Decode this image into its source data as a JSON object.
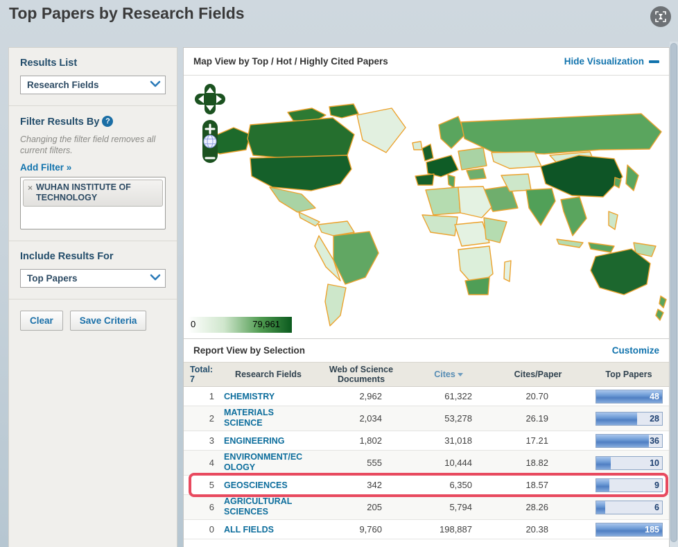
{
  "header": {
    "title": "Top Papers by Research Fields"
  },
  "icons": {
    "expand": "expand-hourglass-icon",
    "help": "?",
    "dropdown_chevron": "chevron-down-icon",
    "remove_tag": "×",
    "hide_dash": "minus-icon",
    "sort": "triangle-down-icon",
    "map_pan": "pan-arrows-icon",
    "map_zoom_in": "+",
    "map_globe": "globe-icon",
    "map_zoom_out": "−"
  },
  "sidebar": {
    "results_list": {
      "label": "Results List",
      "selected": "Research Fields"
    },
    "filter": {
      "heading": "Filter Results By",
      "note": "Changing the filter field removes all current filters.",
      "add_filter_label": "Add Filter »",
      "tag": {
        "remove": "×",
        "label": "WUHAN INSTITUTE OF TECHNOLOGY"
      }
    },
    "include_results": {
      "label": "Include Results For",
      "selected": "Top Papers"
    },
    "actions": {
      "clear": "Clear",
      "save": "Save Criteria"
    }
  },
  "map": {
    "title": "Map View by Top / Hot / Highly Cited Papers",
    "hide_link": "Hide Visualization",
    "scale": {
      "min": "0",
      "max": "79,961"
    },
    "colors": {
      "border": "#eca22d",
      "low": "#ffffff",
      "high": "#0b5a1e"
    }
  },
  "report": {
    "title": "Report View by Selection",
    "customize_link": "Customize",
    "total_label": "Total:",
    "total_count": "7",
    "col_field": "Research Fields",
    "col_docs": "Web of Science Documents",
    "col_cites": "Cites",
    "col_cpp": "Cites/Paper",
    "col_top": "Top Papers",
    "sorted_column": "Cites",
    "bar_max": 45,
    "bar_color": "#5586c8",
    "highlight_color": "#e84a5f",
    "rows": [
      {
        "rank": "1",
        "field": "CHEMISTRY",
        "docs": "2,962",
        "cites": "61,322",
        "cites_per_paper": "20.70",
        "top_papers": 48,
        "highlighted": false
      },
      {
        "rank": "2",
        "field": "MATERIALS SCIENCE",
        "docs": "2,034",
        "cites": "53,278",
        "cites_per_paper": "26.19",
        "top_papers": 28,
        "highlighted": false
      },
      {
        "rank": "3",
        "field": "ENGINEERING",
        "docs": "1,802",
        "cites": "31,018",
        "cites_per_paper": "17.21",
        "top_papers": 36,
        "highlighted": false
      },
      {
        "rank": "4",
        "field": "ENVIRONMENT/ECOLOGY",
        "docs": "555",
        "cites": "10,444",
        "cites_per_paper": "18.82",
        "top_papers": 10,
        "highlighted": false
      },
      {
        "rank": "5",
        "field": "GEOSCIENCES",
        "docs": "342",
        "cites": "6,350",
        "cites_per_paper": "18.57",
        "top_papers": 9,
        "highlighted": true
      },
      {
        "rank": "6",
        "field": "AGRICULTURAL SCIENCES",
        "docs": "205",
        "cites": "5,794",
        "cites_per_paper": "28.26",
        "top_papers": 6,
        "highlighted": false
      },
      {
        "rank": "0",
        "field": "ALL FIELDS",
        "docs": "9,760",
        "cites": "198,887",
        "cites_per_paper": "20.38",
        "top_papers": 185,
        "highlighted": false
      }
    ]
  }
}
